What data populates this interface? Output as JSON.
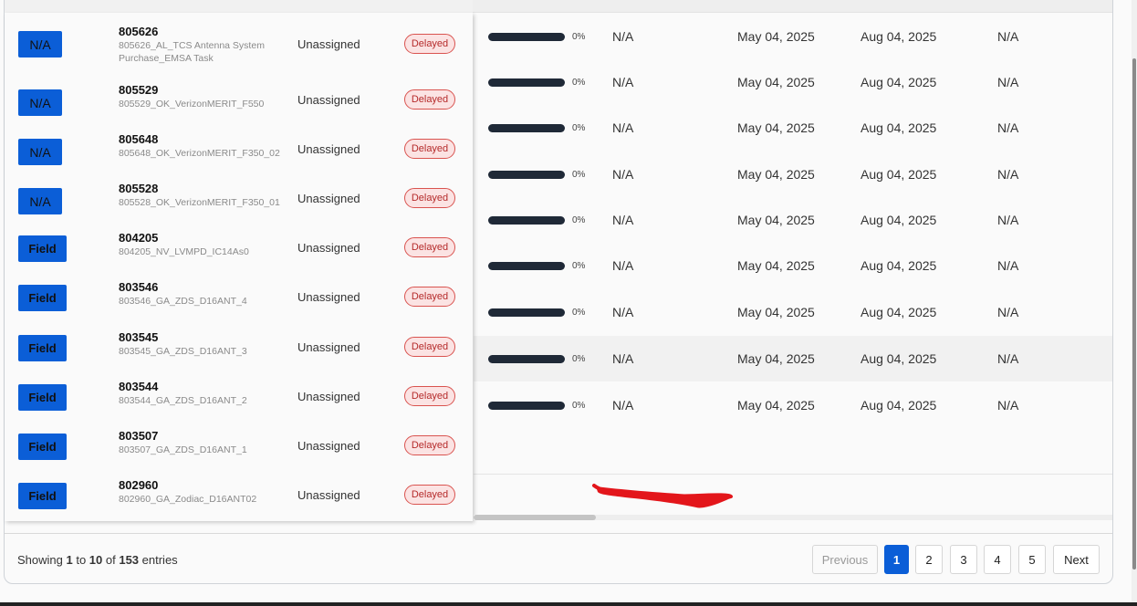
{
  "rows": [
    {
      "type": "N/A",
      "id": "805626",
      "desc": "805626_AL_TCS Antenna System Purchase_EMSA Task",
      "assignee": "Unassigned",
      "status": "Delayed",
      "progress": "0%",
      "col1": "N/A",
      "start": "May 04, 2025",
      "end": "Aug 04, 2025",
      "col2": "N/A"
    },
    {
      "type": "N/A",
      "id": "805529",
      "desc": "805529_OK_VerizonMERIT_F550",
      "assignee": "Unassigned",
      "status": "Delayed",
      "progress": "0%",
      "col1": "N/A",
      "start": "May 04, 2025",
      "end": "Aug 04, 2025",
      "col2": "N/A"
    },
    {
      "type": "N/A",
      "id": "805648",
      "desc": "805648_OK_VerizonMERIT_F350_02",
      "assignee": "Unassigned",
      "status": "Delayed",
      "progress": "0%",
      "col1": "N/A",
      "start": "May 04, 2025",
      "end": "Aug 04, 2025",
      "col2": "N/A"
    },
    {
      "type": "N/A",
      "id": "805528",
      "desc": "805528_OK_VerizonMERIT_F350_01",
      "assignee": "Unassigned",
      "status": "Delayed",
      "progress": "0%",
      "col1": "N/A",
      "start": "May 04, 2025",
      "end": "Aug 04, 2025",
      "col2": "N/A"
    },
    {
      "type": "Field",
      "id": "804205",
      "desc": "804205_NV_LVMPD_IC14As0",
      "assignee": "Unassigned",
      "status": "Delayed",
      "progress": "0%",
      "col1": "N/A",
      "start": "May 04, 2025",
      "end": "Aug 04, 2025",
      "col2": "N/A"
    },
    {
      "type": "Field",
      "id": "803546",
      "desc": "803546_GA_ZDS_D16ANT_4",
      "assignee": "Unassigned",
      "status": "Delayed",
      "progress": "0%",
      "col1": "N/A",
      "start": "May 04, 2025",
      "end": "Aug 04, 2025",
      "col2": "N/A"
    },
    {
      "type": "Field",
      "id": "803545",
      "desc": "803545_GA_ZDS_D16ANT_3",
      "assignee": "Unassigned",
      "status": "Delayed",
      "progress": "0%",
      "col1": "N/A",
      "start": "May 04, 2025",
      "end": "Aug 04, 2025",
      "col2": "N/A"
    },
    {
      "type": "Field",
      "id": "803544",
      "desc": "803544_GA_ZDS_D16ANT_2",
      "assignee": "Unassigned",
      "status": "Delayed",
      "progress": "0%",
      "col1": "N/A",
      "start": "May 04, 2025",
      "end": "Aug 04, 2025",
      "col2": "N/A"
    },
    {
      "type": "Field",
      "id": "803507",
      "desc": "803507_GA_ZDS_D16ANT_1",
      "assignee": "Unassigned",
      "status": "Delayed",
      "progress": "0%",
      "col1": "N/A",
      "start": "May 04, 2025",
      "end": "Aug 04, 2025",
      "col2": "N/A"
    },
    {
      "type": "Field",
      "id": "802960",
      "desc": "802960_GA_Zodiac_D16ANT02",
      "assignee": "Unassigned",
      "status": "Delayed"
    }
  ],
  "footer": {
    "showing_prefix": "Showing ",
    "from": "1",
    "to_word": " to ",
    "to": "10",
    "of_word": " of ",
    "total": "153",
    "suffix": " entries"
  },
  "pagination": {
    "previous": "Previous",
    "pages": [
      "1",
      "2",
      "3",
      "4",
      "5"
    ],
    "active_page": "1",
    "next": "Next"
  },
  "colors": {
    "accent": "#0b5ed7",
    "status_delayed": "#d9534f",
    "progress_bar": "#1f2937",
    "annotation": "#e3161b"
  }
}
